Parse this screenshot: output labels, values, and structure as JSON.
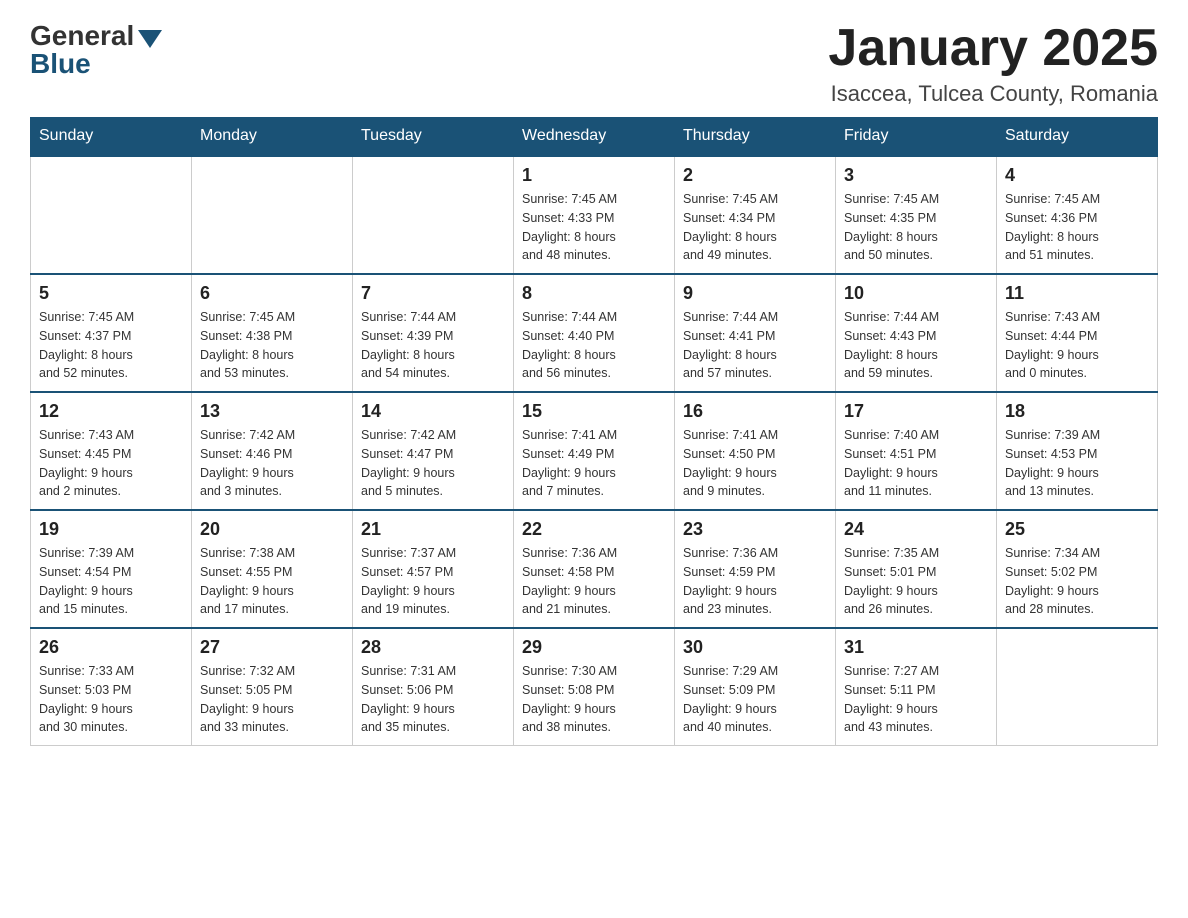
{
  "logo": {
    "general": "General",
    "blue": "Blue"
  },
  "header": {
    "month": "January 2025",
    "location": "Isaccea, Tulcea County, Romania"
  },
  "days": [
    "Sunday",
    "Monday",
    "Tuesday",
    "Wednesday",
    "Thursday",
    "Friday",
    "Saturday"
  ],
  "weeks": [
    [
      {
        "day": "",
        "info": ""
      },
      {
        "day": "",
        "info": ""
      },
      {
        "day": "",
        "info": ""
      },
      {
        "day": "1",
        "info": "Sunrise: 7:45 AM\nSunset: 4:33 PM\nDaylight: 8 hours\nand 48 minutes."
      },
      {
        "day": "2",
        "info": "Sunrise: 7:45 AM\nSunset: 4:34 PM\nDaylight: 8 hours\nand 49 minutes."
      },
      {
        "day": "3",
        "info": "Sunrise: 7:45 AM\nSunset: 4:35 PM\nDaylight: 8 hours\nand 50 minutes."
      },
      {
        "day": "4",
        "info": "Sunrise: 7:45 AM\nSunset: 4:36 PM\nDaylight: 8 hours\nand 51 minutes."
      }
    ],
    [
      {
        "day": "5",
        "info": "Sunrise: 7:45 AM\nSunset: 4:37 PM\nDaylight: 8 hours\nand 52 minutes."
      },
      {
        "day": "6",
        "info": "Sunrise: 7:45 AM\nSunset: 4:38 PM\nDaylight: 8 hours\nand 53 minutes."
      },
      {
        "day": "7",
        "info": "Sunrise: 7:44 AM\nSunset: 4:39 PM\nDaylight: 8 hours\nand 54 minutes."
      },
      {
        "day": "8",
        "info": "Sunrise: 7:44 AM\nSunset: 4:40 PM\nDaylight: 8 hours\nand 56 minutes."
      },
      {
        "day": "9",
        "info": "Sunrise: 7:44 AM\nSunset: 4:41 PM\nDaylight: 8 hours\nand 57 minutes."
      },
      {
        "day": "10",
        "info": "Sunrise: 7:44 AM\nSunset: 4:43 PM\nDaylight: 8 hours\nand 59 minutes."
      },
      {
        "day": "11",
        "info": "Sunrise: 7:43 AM\nSunset: 4:44 PM\nDaylight: 9 hours\nand 0 minutes."
      }
    ],
    [
      {
        "day": "12",
        "info": "Sunrise: 7:43 AM\nSunset: 4:45 PM\nDaylight: 9 hours\nand 2 minutes."
      },
      {
        "day": "13",
        "info": "Sunrise: 7:42 AM\nSunset: 4:46 PM\nDaylight: 9 hours\nand 3 minutes."
      },
      {
        "day": "14",
        "info": "Sunrise: 7:42 AM\nSunset: 4:47 PM\nDaylight: 9 hours\nand 5 minutes."
      },
      {
        "day": "15",
        "info": "Sunrise: 7:41 AM\nSunset: 4:49 PM\nDaylight: 9 hours\nand 7 minutes."
      },
      {
        "day": "16",
        "info": "Sunrise: 7:41 AM\nSunset: 4:50 PM\nDaylight: 9 hours\nand 9 minutes."
      },
      {
        "day": "17",
        "info": "Sunrise: 7:40 AM\nSunset: 4:51 PM\nDaylight: 9 hours\nand 11 minutes."
      },
      {
        "day": "18",
        "info": "Sunrise: 7:39 AM\nSunset: 4:53 PM\nDaylight: 9 hours\nand 13 minutes."
      }
    ],
    [
      {
        "day": "19",
        "info": "Sunrise: 7:39 AM\nSunset: 4:54 PM\nDaylight: 9 hours\nand 15 minutes."
      },
      {
        "day": "20",
        "info": "Sunrise: 7:38 AM\nSunset: 4:55 PM\nDaylight: 9 hours\nand 17 minutes."
      },
      {
        "day": "21",
        "info": "Sunrise: 7:37 AM\nSunset: 4:57 PM\nDaylight: 9 hours\nand 19 minutes."
      },
      {
        "day": "22",
        "info": "Sunrise: 7:36 AM\nSunset: 4:58 PM\nDaylight: 9 hours\nand 21 minutes."
      },
      {
        "day": "23",
        "info": "Sunrise: 7:36 AM\nSunset: 4:59 PM\nDaylight: 9 hours\nand 23 minutes."
      },
      {
        "day": "24",
        "info": "Sunrise: 7:35 AM\nSunset: 5:01 PM\nDaylight: 9 hours\nand 26 minutes."
      },
      {
        "day": "25",
        "info": "Sunrise: 7:34 AM\nSunset: 5:02 PM\nDaylight: 9 hours\nand 28 minutes."
      }
    ],
    [
      {
        "day": "26",
        "info": "Sunrise: 7:33 AM\nSunset: 5:03 PM\nDaylight: 9 hours\nand 30 minutes."
      },
      {
        "day": "27",
        "info": "Sunrise: 7:32 AM\nSunset: 5:05 PM\nDaylight: 9 hours\nand 33 minutes."
      },
      {
        "day": "28",
        "info": "Sunrise: 7:31 AM\nSunset: 5:06 PM\nDaylight: 9 hours\nand 35 minutes."
      },
      {
        "day": "29",
        "info": "Sunrise: 7:30 AM\nSunset: 5:08 PM\nDaylight: 9 hours\nand 38 minutes."
      },
      {
        "day": "30",
        "info": "Sunrise: 7:29 AM\nSunset: 5:09 PM\nDaylight: 9 hours\nand 40 minutes."
      },
      {
        "day": "31",
        "info": "Sunrise: 7:27 AM\nSunset: 5:11 PM\nDaylight: 9 hours\nand 43 minutes."
      },
      {
        "day": "",
        "info": ""
      }
    ]
  ]
}
